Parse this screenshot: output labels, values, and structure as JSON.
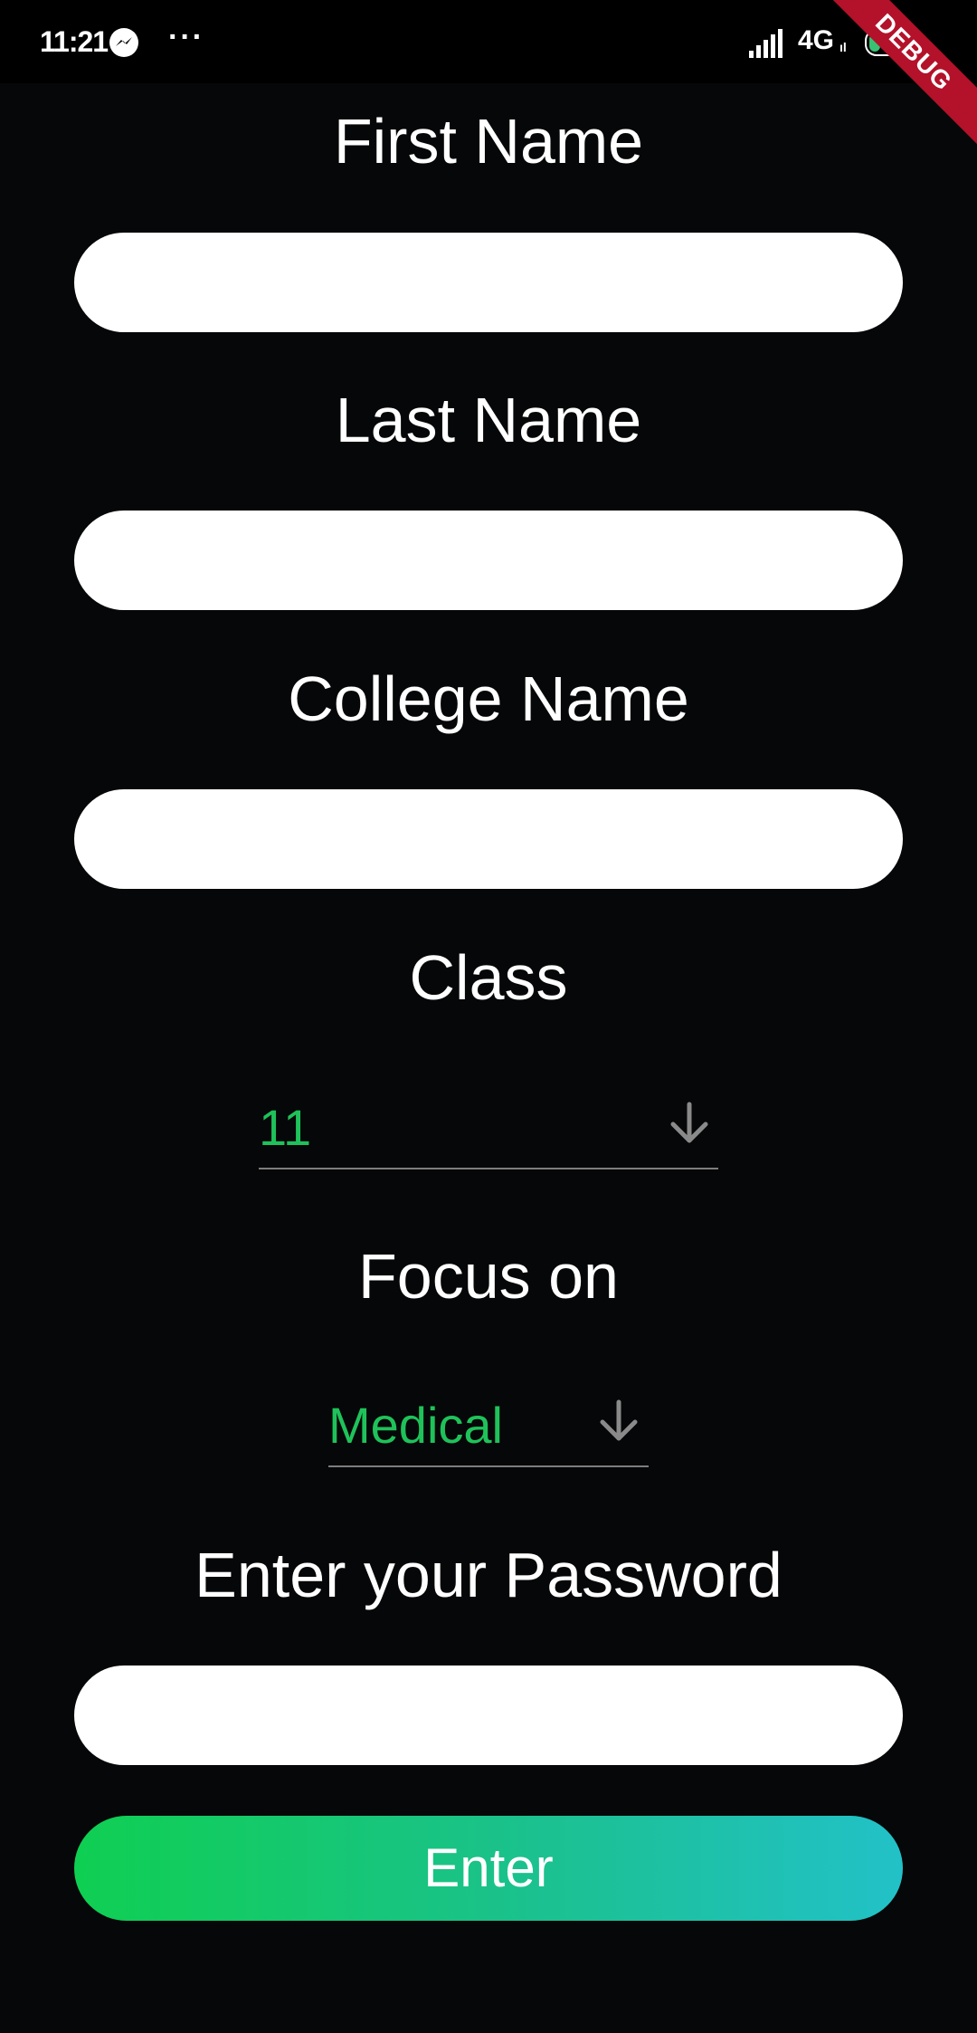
{
  "status_bar": {
    "time": "11:21",
    "more": "···",
    "network": "4G",
    "network_sub": "ıl",
    "battery": "20",
    "debug_label": "DEBUG"
  },
  "form": {
    "first_name_label": "First Name",
    "first_name_value": "",
    "last_name_label": "Last Name",
    "last_name_value": "",
    "college_name_label": "College Name",
    "college_name_value": "",
    "class_label": "Class",
    "class_value": "11",
    "focus_label": "Focus on",
    "focus_value": "Medical",
    "password_label": "Enter your Password",
    "password_value": "",
    "enter_button": "Enter"
  },
  "colors": {
    "background": "#060708",
    "dropdown_text": "#1fc25a",
    "button_gradient_start": "#0fcf52",
    "button_gradient_end": "#22c1c8",
    "debug_banner": "#b3122a"
  },
  "icons": {
    "messenger": "messenger-icon",
    "signal": "signal-bars-icon",
    "battery": "battery-icon",
    "dropdown_arrow": "arrow-down-icon"
  }
}
